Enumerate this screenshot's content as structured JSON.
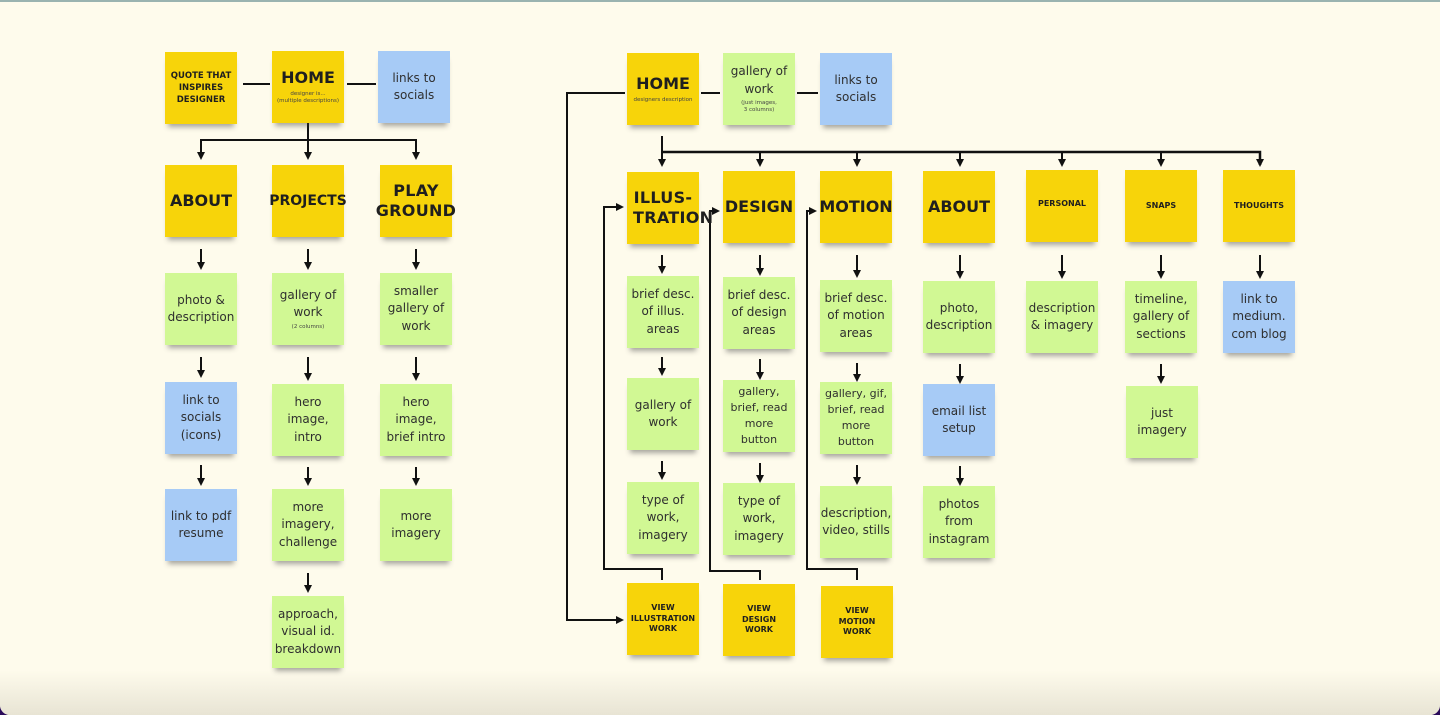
{
  "colors": {
    "background": "#fefbec",
    "yellow_note": "#f7d40a",
    "green_note": "#d1f894",
    "blue_note": "#a7cbf6",
    "connector": "#111111"
  },
  "left_sitemap": {
    "top_row": {
      "quote": {
        "title": "QUOTE THAT INSPIRES DESIGNER"
      },
      "home": {
        "title": "HOME",
        "sub1": "designer is...",
        "sub2": "(multiple descriptions)"
      },
      "socials": {
        "text": "links to socials"
      }
    },
    "columns": [
      {
        "header": "ABOUT",
        "children": [
          {
            "text": "photo & description",
            "color": "green"
          },
          {
            "text": "link to socials (icons)",
            "color": "blue"
          },
          {
            "text": "link to pdf resume",
            "color": "blue"
          }
        ]
      },
      {
        "header": "PROJECTS",
        "children": [
          {
            "text": "gallery of work",
            "sub": "(2 columns)",
            "color": "green"
          },
          {
            "text": "hero image, intro",
            "color": "green"
          },
          {
            "text": "more imagery, challenge",
            "color": "green"
          },
          {
            "text": "approach, visual id. breakdown",
            "color": "green"
          }
        ]
      },
      {
        "header": "PLAY GROUND",
        "children": [
          {
            "text": "smaller gallery of work",
            "color": "green"
          },
          {
            "text": "hero image, brief intro",
            "color": "green"
          },
          {
            "text": "more imagery",
            "color": "green"
          }
        ]
      }
    ]
  },
  "right_sitemap": {
    "top_row": {
      "home": {
        "title": "HOME",
        "sub": "designers description"
      },
      "gallery": {
        "text": "gallery of work",
        "sub1": "(just images,",
        "sub2": "3 columns)"
      },
      "socials": {
        "text": "links to socials"
      }
    },
    "columns": [
      {
        "header": "ILLUS-TRATION",
        "children": [
          {
            "text": "brief desc. of illus. areas",
            "color": "green"
          },
          {
            "text": "gallery of work",
            "color": "green"
          },
          {
            "text": "type of work, imagery",
            "color": "green"
          }
        ],
        "footer": "VIEW ILLUSTRATION WORK"
      },
      {
        "header": "DESIGN",
        "children": [
          {
            "text": "brief desc. of design areas",
            "color": "green"
          },
          {
            "text": "gallery, brief, read more button",
            "color": "green"
          },
          {
            "text": "type of work, imagery",
            "color": "green"
          }
        ],
        "footer": "VIEW DESIGN WORK"
      },
      {
        "header": "MOTION",
        "children": [
          {
            "text": "brief desc. of motion areas",
            "color": "green"
          },
          {
            "text": "gallery, gif, brief, read more button",
            "color": "green"
          },
          {
            "text": "description, video, stills",
            "color": "green"
          }
        ],
        "footer": "VIEW MOTION WORK"
      },
      {
        "header": "ABOUT",
        "children": [
          {
            "text": "photo, description",
            "color": "green"
          },
          {
            "text": "email list setup",
            "color": "blue"
          },
          {
            "text": "photos from instagram",
            "color": "green"
          }
        ]
      },
      {
        "header": "PERSONAL",
        "children": [
          {
            "text": "description & imagery",
            "color": "green"
          }
        ]
      },
      {
        "header": "SNAPS",
        "children": [
          {
            "text": "timeline, gallery of sections",
            "color": "green"
          },
          {
            "text": "just imagery",
            "color": "green"
          }
        ]
      },
      {
        "header": "THOUGHTS",
        "children": [
          {
            "text": "link to medium. com blog",
            "color": "blue"
          }
        ]
      }
    ]
  }
}
